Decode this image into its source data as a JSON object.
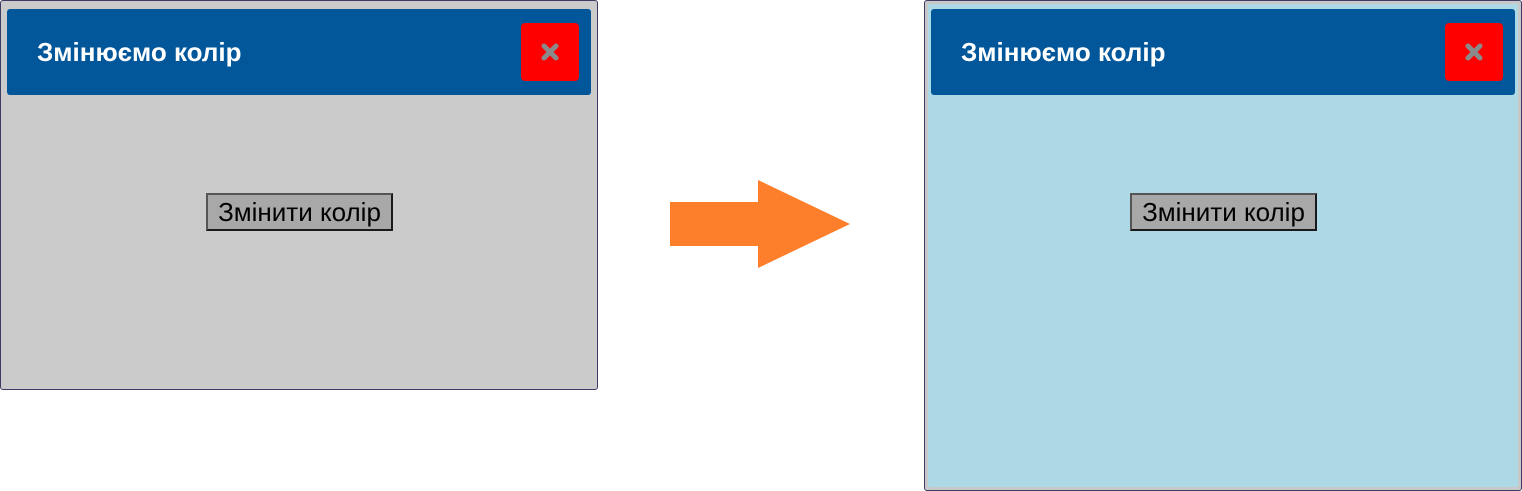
{
  "before": {
    "window_title": "Змінюємо колір",
    "button_label": "Змінити колір",
    "background_color": "#cbcbcb"
  },
  "after": {
    "window_title": "Змінюємо колір",
    "button_label": "Змінити колір",
    "background_color": "#add8e6"
  },
  "colors": {
    "titlebar": "#02579a",
    "close_button": "#ff0000",
    "arrow": "#fd7e2b"
  },
  "icons": {
    "close": "close-icon",
    "arrow": "arrow-right-icon"
  }
}
